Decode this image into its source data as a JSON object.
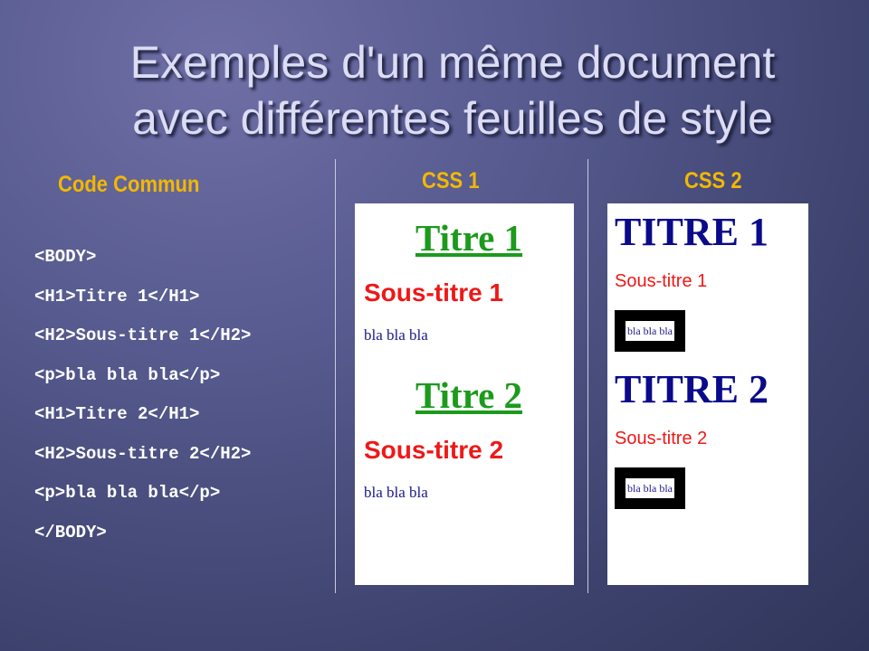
{
  "title": {
    "line1": "Exemples d'un même document",
    "line2": "avec différentes feuilles de style"
  },
  "headings": {
    "common": "Code Commun",
    "css1": "CSS 1",
    "css2": "CSS 2"
  },
  "code_lines": [
    "<BODY>",
    "<H1>Titre 1</H1>",
    "<H2>Sous-titre 1</H2>",
    "<p>bla bla bla</p>",
    "<H1>Titre 2</H1>",
    "<H2>Sous-titre 2</H2>",
    "<p>bla bla bla</p>",
    "</BODY>"
  ],
  "css1": {
    "h1_1": "Titre 1",
    "h2_1": "Sous-titre 1",
    "p_1": "bla bla bla",
    "h1_2": "Titre 2",
    "h2_2": "Sous-titre 2",
    "p_2": "bla bla bla"
  },
  "css2": {
    "h1_1": "TITRE 1",
    "h2_1": "Sous-titre 1",
    "p_1": "bla bla bla",
    "h1_2": "TITRE 2",
    "h2_2": "Sous-titre 2",
    "p_2": "bla bla bla"
  },
  "colors": {
    "heading": "#f2b800",
    "css1_h1": "#1c9a1c",
    "css1_h2": "#ee1818",
    "css2_h1": "#0a0a8a"
  }
}
